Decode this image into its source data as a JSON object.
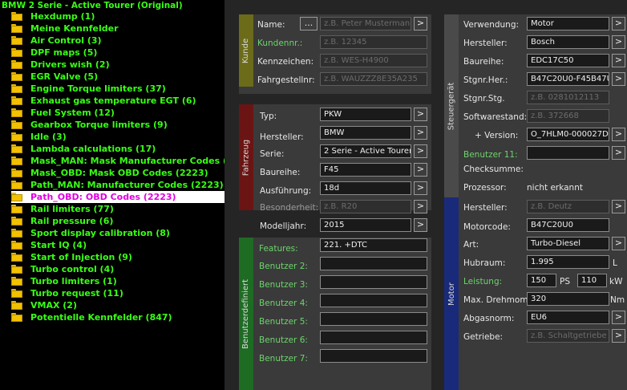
{
  "colors": {
    "tree_text": "#39ff14",
    "selected_text": "#e000e0",
    "kunde": "#6b6b1a",
    "fahrzeug": "#6b1414",
    "benutzer": "#1e6b23",
    "steuergeraet": "#4a4a4a",
    "motor": "#1a2a7a"
  },
  "tree": {
    "root": "BMW 2 Serie - Active Tourer (Original)",
    "items": [
      "Hexdump (1)",
      "Meine Kennfelder",
      "Air Control (3)",
      "DPF maps (5)",
      "Drivers wish (2)",
      "EGR Valve (5)",
      "Engine Torque limiters (37)",
      "Exhaust gas temperature EGT (6)",
      "Fuel System (12)",
      "Gearbox Torque limiters (9)",
      "Idle (3)",
      "Lambda calculations (17)",
      "Mask_MAN: Mask Manufacturer Codes (222",
      "Mask_OBD: Mask OBD Codes (2223)",
      "Path_MAN: Manufacturer Codes (2223)",
      "Path_OBD: OBD Codes (2223)",
      "Rail limiters (77)",
      "Rail pressure (6)",
      "Sport display calibration (8)",
      "Start IQ (4)",
      "Start of Injection (9)",
      "Turbo control (4)",
      "Turbo limiters (1)",
      "Turbo request (11)",
      "VMAX (2)",
      "Potentielle Kennfelder (847)"
    ],
    "selected_index": 15
  },
  "kunde": {
    "title": "Kunde",
    "name_label": "Name:",
    "name_btn": "...",
    "name_ph": "z.B. Peter Mustermann",
    "name_arrow": ">",
    "kdnr_label": "Kundennr.:",
    "kdnr_ph": "z.B. 12345",
    "kz_label": "Kennzeichen:",
    "kz_ph": "z.B. WES-H4900",
    "fgn_label": "Fahrgestellnr:",
    "fgn_ph": "z.B. WAUZZZ8E35A235"
  },
  "fahrzeug": {
    "title": "Fahrzeug",
    "typ_label": "Typ:",
    "typ": "PKW",
    "hersteller_label": "Hersteller:",
    "hersteller": "BMW",
    "serie_label": "Serie:",
    "serie": "2 Serie - Active Tourer",
    "baureihe_label": "Baureihe:",
    "baureihe": "F45",
    "ausfuehrung_label": "Ausführung:",
    "ausfuehrung": "18d",
    "besonderheit_label": "Besonderheit:",
    "besonderheit_ph": "z.B. R20",
    "modelljahr_label": "Modelljahr:",
    "modelljahr": "2015",
    "arrow": ">"
  },
  "benutzer": {
    "title": "Benutzerdefiniert",
    "features_label": "Features:",
    "features": "221. +DTC",
    "labels": [
      "Benutzer 2:",
      "Benutzer 3:",
      "Benutzer 4:",
      "Benutzer 5:",
      "Benutzer 6:",
      "Benutzer 7:"
    ]
  },
  "steuergeraet": {
    "title": "Steuergerät",
    "verwendung_label": "Verwendung:",
    "verwendung": "Motor",
    "hersteller_label": "Hersteller:",
    "hersteller": "Bosch",
    "baureihe_label": "Baureihe:",
    "baureihe": "EDC17C50",
    "stgnr_her_label": "Stgnr.Her.:",
    "stgnr_her": "B47C20U0-F45B47U",
    "stgnr_stg_label": "Stgnr.Stg.",
    "stgnr_stg_ph": "z.B. 0281012113",
    "softwarestand_label": "Softwarestand:",
    "softwarestand_ph": "z.B. 372668",
    "version_label": "+ Version:",
    "version": "O_7HLM0-000027D",
    "benutzer11_label": "Benutzer 11:",
    "checksumme_label": "Checksumme:",
    "prozessor_label": "Prozessor:",
    "prozessor": "nicht erkannt",
    "arrow": ">"
  },
  "motor": {
    "title": "Motor",
    "hersteller_label": "Hersteller:",
    "hersteller_ph": "z.B. Deutz",
    "motorcode_label": "Motorcode:",
    "motorcode": "B47C20U0",
    "art_label": "Art:",
    "art": "Turbo-Diesel",
    "hubraum_label": "Hubraum:",
    "hubraum": "1.995",
    "hubraum_unit": "L",
    "leistung_label": "Leistung:",
    "leistung_ps": "150",
    "ps_unit": "PS",
    "leistung_kw": "110",
    "kw_unit": "kW",
    "drehmom_label": "Max. Drehmom.",
    "drehmom": "320",
    "nm_unit": "Nm",
    "abgasnorm_label": "Abgasnorm:",
    "abgasnorm": "EU6",
    "getriebe_label": "Getriebe:",
    "getriebe_ph": "z.B. Schaltgetriebe",
    "arrow": ">"
  }
}
